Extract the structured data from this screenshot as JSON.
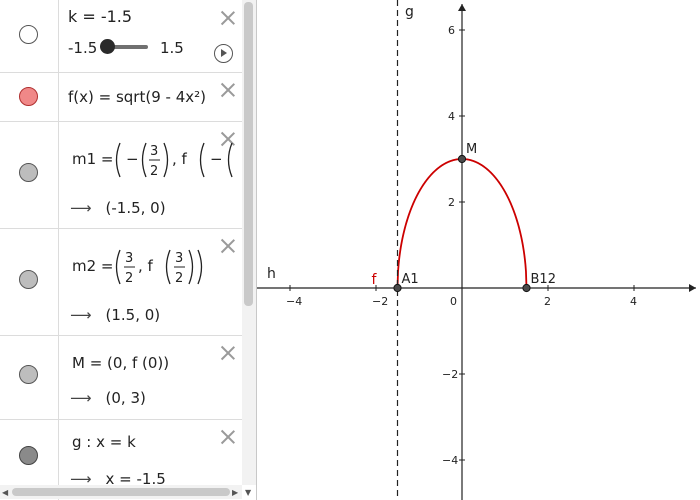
{
  "algebra": {
    "k_row": {
      "label": "k = -1.5",
      "slider_min": "-1.5",
      "slider_max": "1.5",
      "value": -1.5
    },
    "f_row": {
      "definition": "f(x) = sqrt(9 - 4x²)",
      "color": "#e65a5a"
    },
    "m1_row": {
      "lhs": "m1 =",
      "paren_open": "(",
      "minus": "−",
      "num": "3",
      "den": "2",
      "comma_f": ", f",
      "result": "(-1.5, 0)"
    },
    "m2_row": {
      "lhs": "m2 =",
      "num": "3",
      "den": "2",
      "comma_f": ", f",
      "result": "(1.5, 0)"
    },
    "M_row": {
      "definition": "M = (0, f (0))",
      "result": "(0, 3)"
    },
    "g_row": {
      "definition": "g : x = k",
      "result": "x = -1.5"
    },
    "arrow_glyph": "⟶"
  },
  "graphics": {
    "axis_labels": {
      "g": "g",
      "h": "h",
      "f": "f"
    },
    "points": [
      {
        "name": "A",
        "label": "A1",
        "x": -1.5,
        "y": 0
      },
      {
        "name": "B",
        "label": "B12",
        "x": 1.5,
        "y": 0
      },
      {
        "name": "M",
        "label": "M",
        "x": 0,
        "y": 3
      }
    ],
    "x_ticks": [
      "−4",
      "−2",
      "0",
      "2",
      "4"
    ],
    "y_ticks": [
      "6",
      "4",
      "2",
      "−2",
      "−4"
    ],
    "curve_color": "#cc0000",
    "line_g_x": -1.5
  },
  "chart_data": {
    "type": "line",
    "title": "",
    "xlabel": "",
    "ylabel": "",
    "xlim": [
      -4.5,
      5.5
    ],
    "ylim": [
      -4.6,
      6.7
    ],
    "series": [
      {
        "name": "f",
        "function": "sqrt(9 - 4x²)",
        "domain": [
          -1.5,
          1.5
        ]
      }
    ],
    "vertical_lines": [
      {
        "name": "g",
        "x": -1.5
      }
    ],
    "horizontal_lines": [
      {
        "name": "h",
        "y": 0
      }
    ],
    "points": [
      {
        "name": "A1",
        "x": -1.5,
        "y": 0
      },
      {
        "name": "B12",
        "x": 1.5,
        "y": 0
      },
      {
        "name": "M",
        "x": 0,
        "y": 3
      }
    ],
    "x_ticks": [
      -4,
      -2,
      0,
      2,
      4
    ],
    "y_ticks": [
      -4,
      -2,
      2,
      4,
      6
    ],
    "grid": false
  }
}
